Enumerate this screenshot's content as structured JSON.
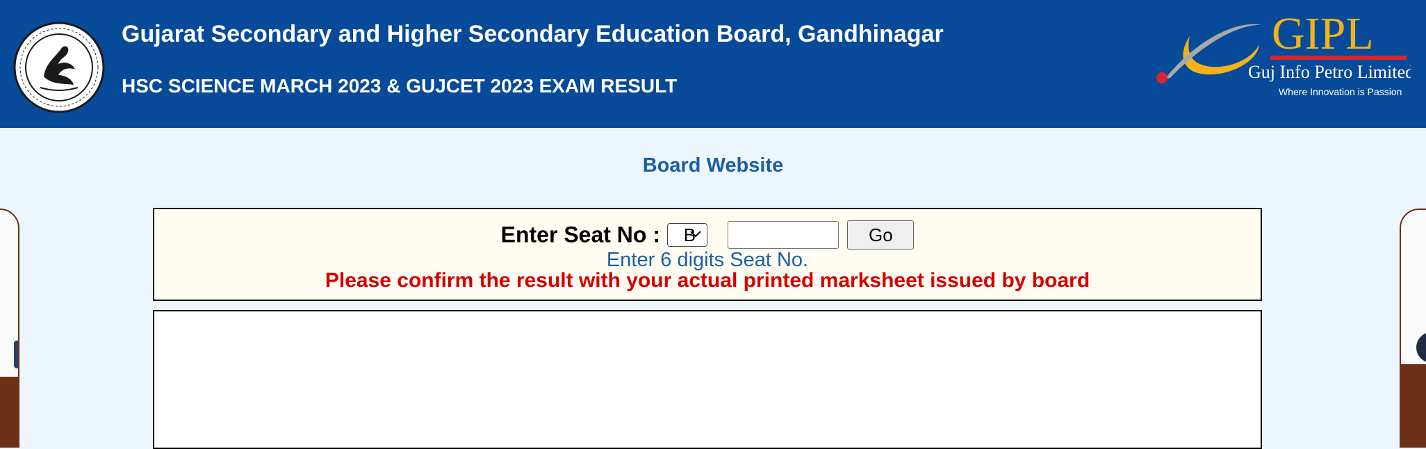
{
  "header": {
    "title": "Gujarat Secondary and Higher Secondary Education Board, Gandhinagar",
    "subtitle": "HSC SCIENCE MARCH 2023 & GUJCET 2023 EXAM RESULT",
    "board_logo_icon": "board-seal-swan-icon",
    "partner_logo": {
      "brand": "GIPL",
      "name": "Guj Info Petro Limited",
      "tagline": "Where Innovation is Passion"
    },
    "colors": {
      "bar": "#074a99",
      "text": "#ffffff",
      "gipl_gold": "#f3b21a",
      "gipl_red": "#d7262f"
    }
  },
  "board_link": "Board Website",
  "form": {
    "seat_label": "Enter Seat No :",
    "series_selected": "B",
    "seat_value": "",
    "go_label": "Go",
    "hint": "Enter 6 digits Seat No.",
    "warning": "Please confirm the result with your actual printed marksheet issued by board",
    "colors": {
      "hint": "#1a5ea8",
      "warning": "#d40000",
      "box_bg": "#fffdf2"
    }
  },
  "result": {
    "content": ""
  }
}
